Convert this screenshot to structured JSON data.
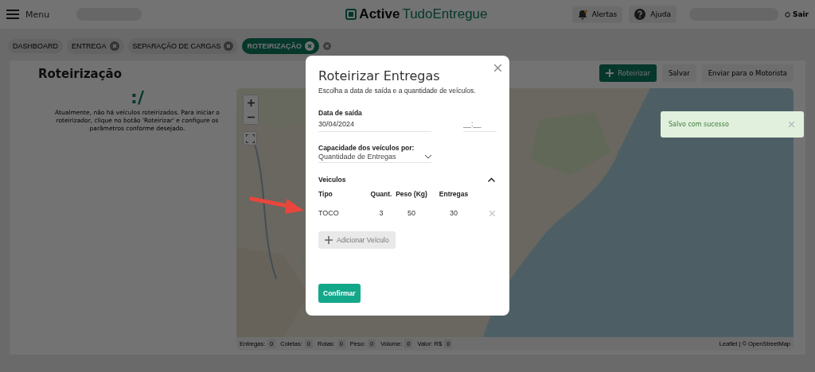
{
  "header": {
    "menu_label": "Menu",
    "logo": {
      "bold": "Active",
      "light": "TudoEntregue"
    },
    "buttons": [
      {
        "kind": "bell",
        "label": "Alertas"
      },
      {
        "kind": "help",
        "label": "Ajuda"
      }
    ],
    "logout": "Sair"
  },
  "tabs": [
    {
      "label": "DASHBOARD",
      "selected": false,
      "closable": false
    },
    {
      "label": "ENTREGA",
      "selected": false,
      "closable": true
    },
    {
      "label": "SEPARAÇÃO DE CARGAS",
      "selected": false,
      "closable": true
    },
    {
      "label": "ROTEIRIZAÇÃO",
      "selected": true,
      "closable": true
    }
  ],
  "page": {
    "title": "Roteirização",
    "empty_face": ":/",
    "empty_message": "Atualmente, não há veículos roteirizados. Para iniciar o roteirizador, clique no botão 'Roteirizar' e configure os parâmetros conforme desejado.",
    "actions": [
      {
        "kind": "primary",
        "label": "Roteirizar"
      },
      {
        "kind": "plain",
        "label": "Salvar"
      },
      {
        "kind": "plain",
        "label": "Enviar para o Motorista"
      }
    ],
    "map": {
      "kind": "picture",
      "attribution": "Leaflet | © OpenStreetMap"
    },
    "stats": [
      {
        "label": "Entregas:",
        "value": "0"
      },
      {
        "label": "Coletas:",
        "value": "0"
      },
      {
        "label": "Rotas:",
        "value": "0"
      },
      {
        "label": "Peso:",
        "value": "0"
      },
      {
        "label": "Volume:",
        "value": "0"
      },
      {
        "label": "Valor: R$",
        "value": "0"
      }
    ]
  },
  "toast": {
    "message": "Salvo com sucesso"
  },
  "modal": {
    "title": "Roteirizar Entregas",
    "subtitle": "Escolha a data de saída e a quantidade de veículos.",
    "date_label": "Data de saída",
    "date_value": "30/04/2024",
    "time_placeholder": "__:__",
    "capacity_label": "Capacidade dos veículos por:",
    "capacity_value": "Quantidade de Entregas",
    "vehicles": {
      "title": "Veiculos",
      "expanded": true,
      "columns": [
        "Tipo",
        "Quant.",
        "Peso (Kg)",
        "Entregas"
      ],
      "rows": [
        [
          "TOCO",
          "3",
          "50",
          "30"
        ]
      ]
    },
    "add_button": "Adicionar Veículo",
    "confirm_button": "Confirmar"
  }
}
